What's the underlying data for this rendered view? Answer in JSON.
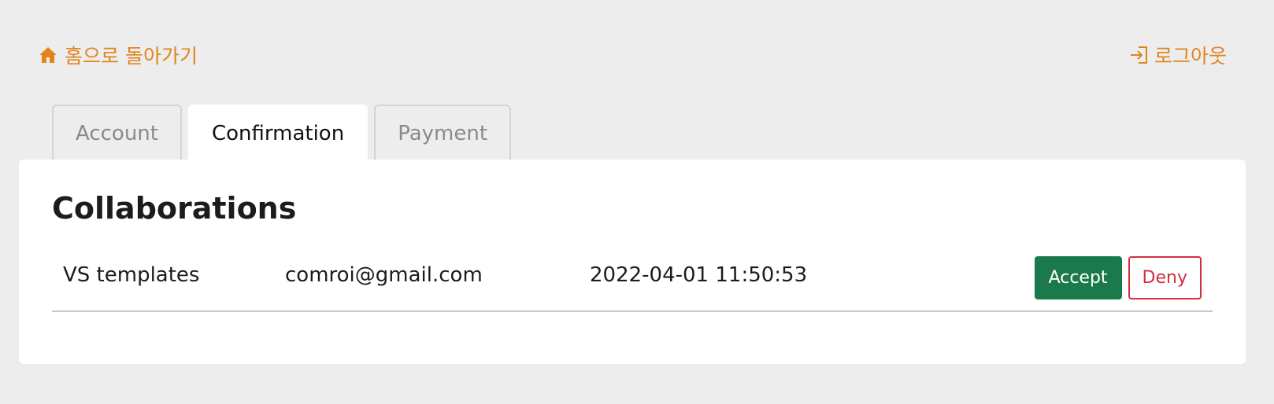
{
  "topbar": {
    "home_label": "홈으로 돌아가기",
    "home_icon": "home-icon",
    "logout_label": "로그아웃",
    "logout_icon": "login-arrow-icon",
    "link_color": "#e0851c"
  },
  "tabs": [
    {
      "label": "Account",
      "active": false
    },
    {
      "label": "Confirmation",
      "active": true
    },
    {
      "label": "Payment",
      "active": false
    }
  ],
  "panel": {
    "title": "Collaborations",
    "rows": [
      {
        "name": "VS templates",
        "email": "comroi@gmail.com",
        "date": "2022-04-01 11:50:53",
        "accept_label": "Accept",
        "deny_label": "Deny"
      }
    ]
  },
  "colors": {
    "background": "#ededed",
    "accept": "#1b7a4c",
    "deny": "#d32f3f"
  }
}
